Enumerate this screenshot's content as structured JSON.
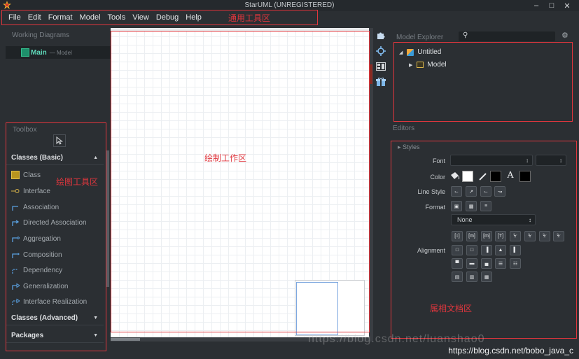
{
  "titlebar": {
    "title": "StarUML (UNREGISTERED)",
    "minimize": "–",
    "maximize": "□",
    "close": "✕"
  },
  "menubar": {
    "items": [
      "File",
      "Edit",
      "Format",
      "Model",
      "Tools",
      "View",
      "Debug",
      "Help"
    ]
  },
  "annotations": {
    "menu": "通用工具区",
    "toolbox": "绘图工具区",
    "canvas": "绘制工作区",
    "properties": "属相文档区"
  },
  "working_diagrams": {
    "heading": "Working Diagrams",
    "item_label": "Main",
    "item_sub": "— Model"
  },
  "toolbox": {
    "heading": "Toolbox",
    "groups": [
      {
        "label": "Classes (Basic)",
        "arrow": "▲"
      },
      {
        "label": "Classes (Advanced)",
        "arrow": "▼"
      },
      {
        "label": "Packages",
        "arrow": "▼"
      }
    ],
    "items": [
      "Class",
      "Interface",
      "Association",
      "Directed Association",
      "Aggregation",
      "Composition",
      "Dependency",
      "Generalization",
      "Interface Realization"
    ]
  },
  "model_explorer": {
    "heading": "Model Explorer",
    "root": "Untitled",
    "child": "Model"
  },
  "editors": {
    "heading": "Editors",
    "styles": "Styles",
    "font_label": "Font",
    "color_label": "Color",
    "line_style_label": "Line Style",
    "format_label": "Format",
    "format_value": "None",
    "alignment_label": "Alignment",
    "color_swatch_letter": "A"
  },
  "watermarks": {
    "main": "https://blog.csdn.net/bobo_java_c",
    "faint": "https://blog.csdn.net/luanshao0"
  },
  "colors": {
    "annotation": "#e0363d",
    "accent_diagram": "#5fd9b9"
  }
}
